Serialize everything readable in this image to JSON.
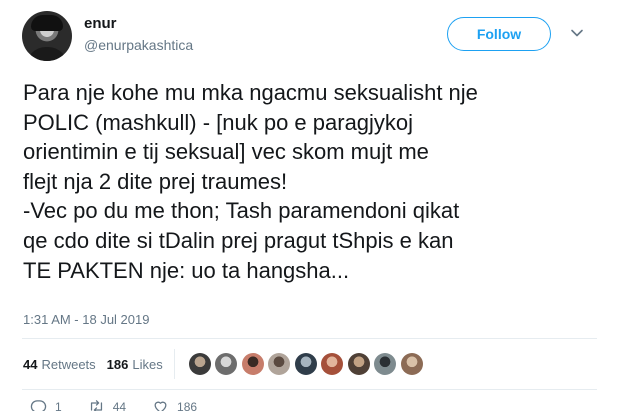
{
  "user": {
    "display_name": "enur",
    "handle": "@enurpakashtica"
  },
  "follow_button": {
    "label": "Follow"
  },
  "tweet": {
    "text": "Para nje kohe mu mka ngacmu seksualisht nje\nPOLIC (mashkull) - [nuk po e paragjykoj\norientimin e tij seksual] vec skom mujt me\nflejt nja 2 dite prej traumes!\n-Vec po du me thon; Tash paramendoni qikat\nqe cdo dite si tDalin prej pragut tShpis e kan\nTE PAKTEN nje: uo ta hangsha...",
    "timestamp": "1:31 AM - 18 Jul 2019"
  },
  "stats": {
    "retweets_count": "44",
    "retweets_label": "Retweets",
    "likes_count": "186",
    "likes_label": "Likes"
  },
  "likers": [
    {
      "color": "#3b3b3b",
      "accent": "#b9a48f"
    },
    {
      "color": "#6d6d6d",
      "accent": "#d8d8d8"
    },
    {
      "color": "#c77d6b",
      "accent": "#3a2a24"
    },
    {
      "color": "#b0a49a",
      "accent": "#5b4a40"
    },
    {
      "color": "#2f3d4a",
      "accent": "#a6b4bf"
    },
    {
      "color": "#a5503a",
      "accent": "#e2b59c"
    },
    {
      "color": "#4f4036",
      "accent": "#c2a284"
    },
    {
      "color": "#7e8b8f",
      "accent": "#2a2f33"
    },
    {
      "color": "#8c6b55",
      "accent": "#d9c1a8"
    }
  ],
  "actions": {
    "reply_count": "1",
    "retweet_count": "44",
    "like_count": "186"
  },
  "colors": {
    "accent": "#1da1f2",
    "text_primary": "#14171a",
    "text_secondary": "#657786",
    "divider": "#e6ecf0"
  }
}
